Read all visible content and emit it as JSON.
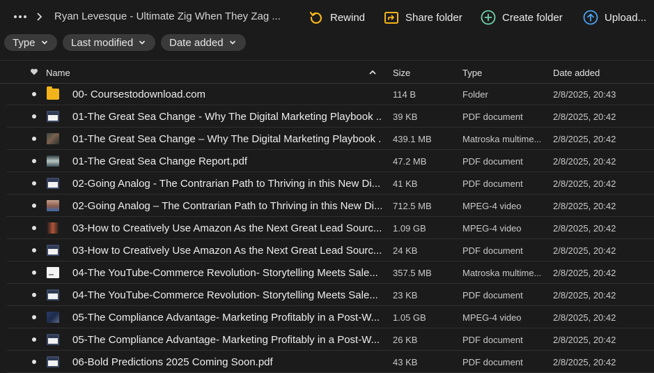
{
  "breadcrumb": {
    "current_folder": "Ryan Levesque - Ultimate Zig When They Zag ..."
  },
  "toolbar": {
    "rewind_label": "Rewind",
    "share_label": "Share folder",
    "create_label": "Create folder",
    "upload_label": "Upload..."
  },
  "filters": {
    "type_label": "Type",
    "modified_label": "Last modified",
    "date_added_label": "Date added"
  },
  "columns": {
    "name": "Name",
    "size": "Size",
    "type": "Type",
    "date_added": "Date added",
    "sort": "ascending"
  },
  "colors": {
    "background": "#1b1b1b",
    "folder": "#f3b41b",
    "rewind_icon": "#f3b41b",
    "share_icon": "#f3b41b",
    "create_icon": "#6fd3a8",
    "upload_icon": "#4aa3f0"
  },
  "files": [
    {
      "name": "00- Coursestodownload.com",
      "size": "114 B",
      "type": "Folder",
      "date_added": "2/8/2025, 20:43",
      "icon": "folder-icon"
    },
    {
      "name": "01-The Great Sea Change - Why The Digital Marketing Playbook ...",
      "size": "39 KB",
      "type": "PDF document",
      "date_added": "2/8/2025, 20:42",
      "icon": "pdf-icon"
    },
    {
      "name": "01-The Great Sea Change – Why The Digital Marketing Playbook ...",
      "size": "439.1 MB",
      "type": "Matroska multime...",
      "date_added": "2/8/2025, 20:42",
      "icon": "video-thumbnail-icon"
    },
    {
      "name": "01-The Great Sea Change Report.pdf",
      "size": "47.2 MB",
      "type": "PDF document",
      "date_added": "2/8/2025, 20:42",
      "icon": "pdf-thumbnail-icon"
    },
    {
      "name": "02-Going Analog - The Contrarian Path to Thriving in this New Di...",
      "size": "41 KB",
      "type": "PDF document",
      "date_added": "2/8/2025, 20:42",
      "icon": "pdf-icon"
    },
    {
      "name": "02-Going Analog – The Contrarian Path to Thriving in this New Di...",
      "size": "712.5 MB",
      "type": "MPEG-4 video",
      "date_added": "2/8/2025, 20:42",
      "icon": "video-thumbnail-icon"
    },
    {
      "name": "03-How to Creatively Use Amazon As the Next Great Lead Sourc...",
      "size": "1.09 GB",
      "type": "MPEG-4 video",
      "date_added": "2/8/2025, 20:42",
      "icon": "video-thumbnail-icon"
    },
    {
      "name": "03-How to Creatively Use Amazon As the Next Great Lead Sourc...",
      "size": "24 KB",
      "type": "PDF document",
      "date_added": "2/8/2025, 20:42",
      "icon": "pdf-icon"
    },
    {
      "name": "04-The YouTube-Commerce Revolution- Storytelling Meets Sale...",
      "size": "357.5 MB",
      "type": "Matroska multime...",
      "date_added": "2/8/2025, 20:42",
      "icon": "video-thumbnail-icon"
    },
    {
      "name": "04-The YouTube-Commerce Revolution- Storytelling Meets Sale...",
      "size": "23 KB",
      "type": "PDF document",
      "date_added": "2/8/2025, 20:42",
      "icon": "pdf-icon"
    },
    {
      "name": "05-The Compliance Advantage- Marketing Profitably in a Post-W...",
      "size": "1.05 GB",
      "type": "MPEG-4 video",
      "date_added": "2/8/2025, 20:42",
      "icon": "video-thumbnail-icon"
    },
    {
      "name": "05-The Compliance Advantage- Marketing Profitably in a Post-W...",
      "size": "26 KB",
      "type": "PDF document",
      "date_added": "2/8/2025, 20:42",
      "icon": "pdf-icon"
    },
    {
      "name": "06-Bold Predictions 2025 Coming Soon.pdf",
      "size": "43 KB",
      "type": "PDF document",
      "date_added": "2/8/2025, 20:42",
      "icon": "pdf-icon"
    }
  ]
}
